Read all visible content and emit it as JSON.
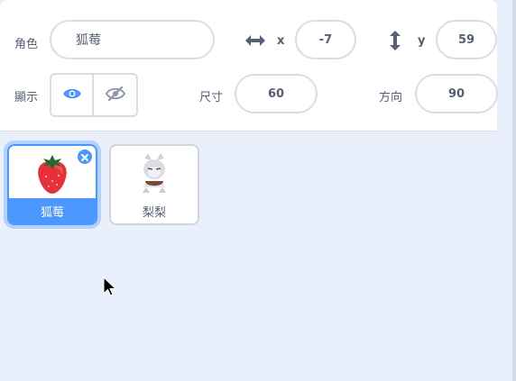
{
  "sprite_info": {
    "sprite_label": "角色",
    "sprite_name": "狐莓",
    "x_label": "x",
    "x_value": "-7",
    "y_label": "y",
    "y_value": "59",
    "show_label": "顯示",
    "size_label": "尺寸",
    "size_value": "60",
    "direction_label": "方向",
    "direction_value": "90"
  },
  "sprites": [
    {
      "name": "狐莓",
      "selected": true,
      "icon": "strawberry"
    },
    {
      "name": "梨梨",
      "selected": false,
      "icon": "fox-character"
    }
  ],
  "colors": {
    "accent": "#4c97ff",
    "text": "#575e75",
    "panel_bg": "#e9f0fb"
  }
}
